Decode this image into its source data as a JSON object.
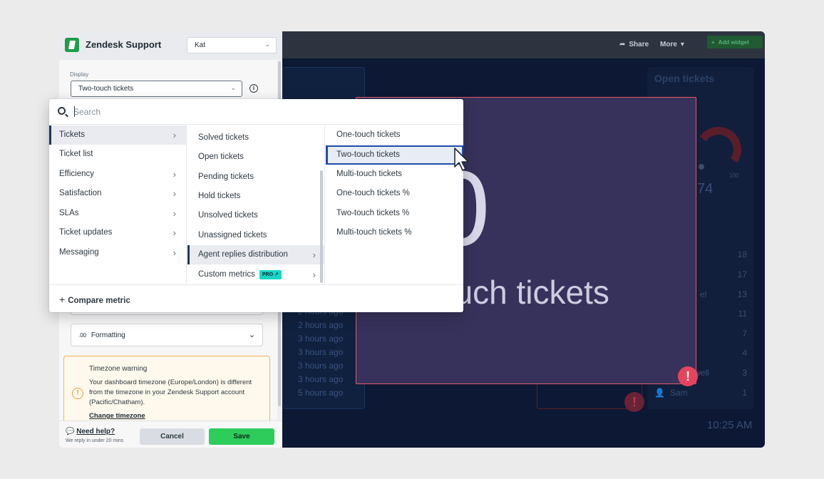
{
  "dashboard": {
    "share_label": "Share",
    "more_label": "More",
    "add_widget_label": "Add widget",
    "time_ago": [
      "2 hours ago",
      "2 hours ago",
      "3 hours ago",
      "3 hours ago",
      "3 hours ago",
      "3 hours ago",
      "5 hours ago"
    ],
    "open_tickets_title": "Open tickets",
    "gauge_value": "74",
    "gauge_max": "100",
    "open_tickets_rows": [
      {
        "name": "",
        "count": "18"
      },
      {
        "name": "",
        "count": "17"
      },
      {
        "name": "el",
        "count": "13"
      },
      {
        "name": "",
        "count": "11"
      },
      {
        "name": "",
        "count": "7"
      },
      {
        "name": "",
        "count": "4"
      },
      {
        "name": "well",
        "count": "3"
      },
      {
        "name": "Sam",
        "count": "1"
      }
    ],
    "clock": "10:25 AM",
    "metric_value": "0",
    "metric_label": "ouch tickets"
  },
  "panel": {
    "app_title": "Zendesk Support",
    "user_select": "Kat",
    "display_label": "Display",
    "display_value": "Two-touch tickets",
    "formatting_prefix": ".00",
    "formatting_label": "Formatting",
    "timezone": {
      "title": "Timezone warning",
      "text": "Your dashboard timezone (Europe/London) is different from the timezone in your Zendesk Support account (Pacific/Chatham).",
      "link": "Change timezone"
    },
    "footer": {
      "help_label": "Need help?",
      "help_sub": "We reply in under 20 mins",
      "cancel_label": "Cancel",
      "save_label": "Save"
    }
  },
  "dropdown": {
    "search_placeholder": "Search",
    "categories": [
      {
        "label": "Tickets",
        "has_arrow": true,
        "selected": true
      },
      {
        "label": "Ticket list",
        "has_arrow": false
      },
      {
        "label": "Efficiency",
        "has_arrow": true
      },
      {
        "label": "Satisfaction",
        "has_arrow": true
      },
      {
        "label": "SLAs",
        "has_arrow": true
      },
      {
        "label": "Ticket updates",
        "has_arrow": true
      },
      {
        "label": "Messaging",
        "has_arrow": true
      }
    ],
    "metrics": [
      {
        "label": "Solved tickets"
      },
      {
        "label": "Open tickets"
      },
      {
        "label": "Pending tickets"
      },
      {
        "label": "Hold tickets"
      },
      {
        "label": "Unsolved tickets"
      },
      {
        "label": "Unassigned tickets"
      },
      {
        "label": "Agent replies distribution",
        "has_arrow": true,
        "selected": true
      },
      {
        "label": "Custom metrics",
        "badge": "PRO",
        "has_arrow": true
      }
    ],
    "submetrics": [
      {
        "label": "One-touch tickets"
      },
      {
        "label": "Two-touch tickets",
        "active": true
      },
      {
        "label": "Multi-touch tickets"
      },
      {
        "label": "One-touch tickets %"
      },
      {
        "label": "Two-touch tickets %"
      },
      {
        "label": "Multi-touch tickets %"
      }
    ],
    "compare_label": "Compare metric"
  },
  "colors": {
    "dashboard_bg": "#0c1834",
    "metric_panel_bg": "#37325b",
    "alert_red": "#e5445e",
    "save_green": "#2ecc5b",
    "selection_blue": "#1f4ea8"
  }
}
